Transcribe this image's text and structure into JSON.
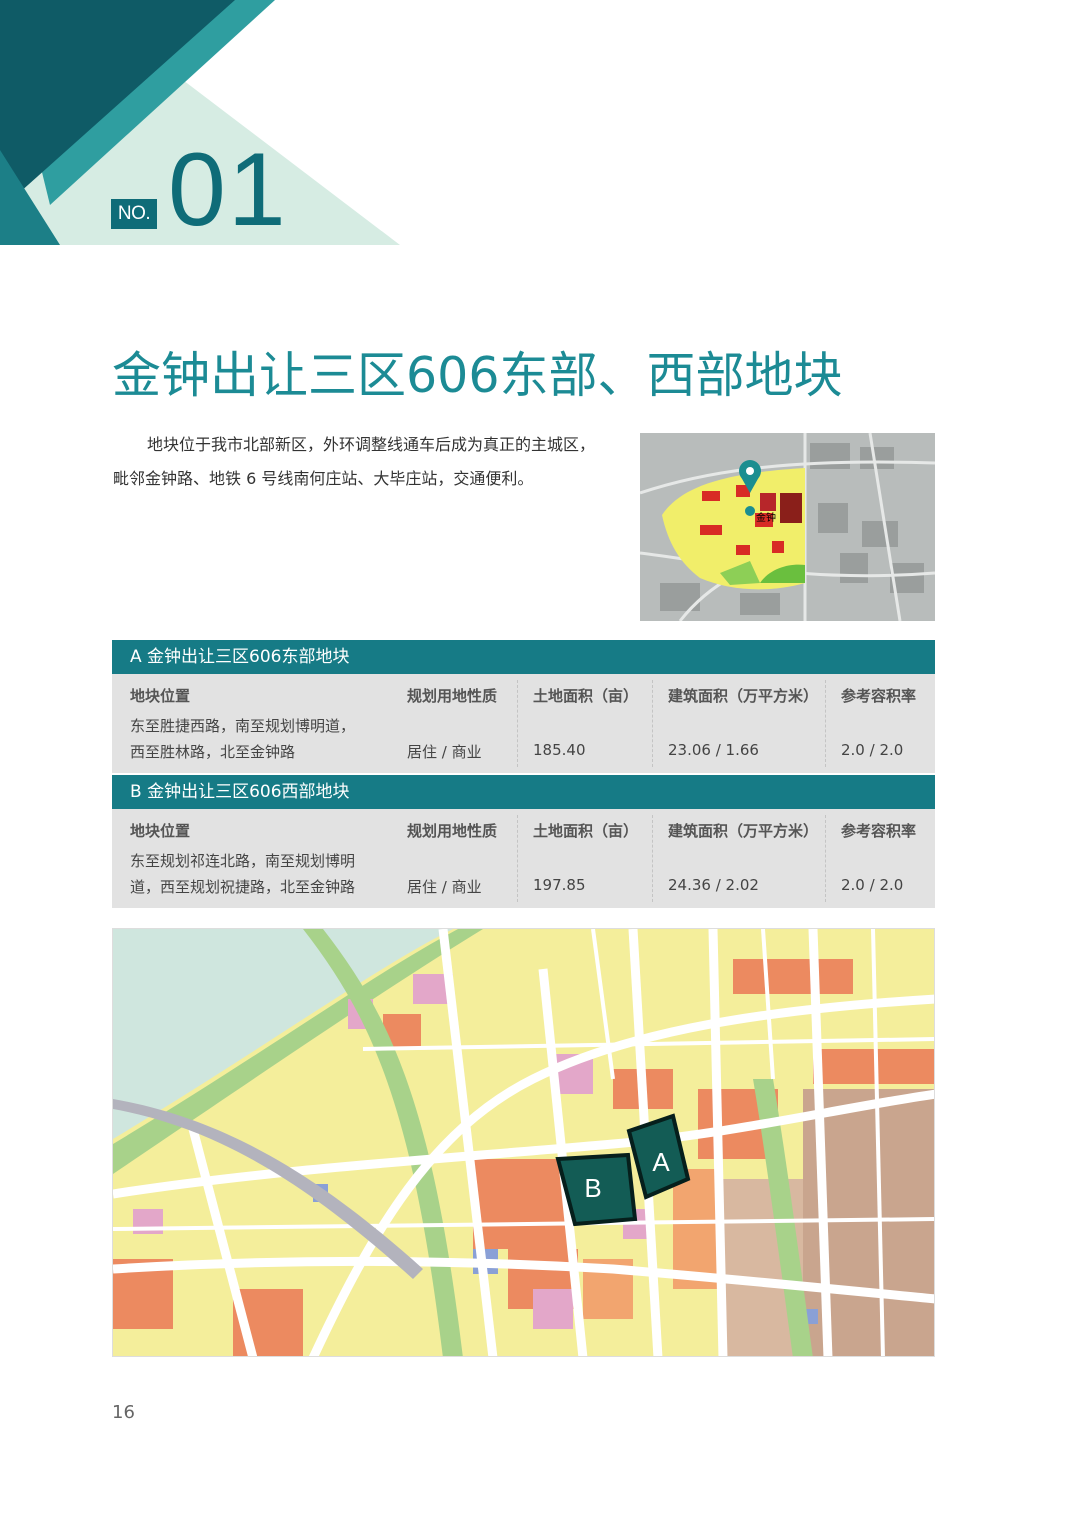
{
  "header": {
    "no_label": "NO.",
    "number": "01"
  },
  "title": "金钟出让三区606东部、西部地块",
  "intro": {
    "line1": "地块位于我市北部新区，外环调整线通车后成为真正的主城区，",
    "line2": "毗邻金钟路、地铁 6 号线南何庄站、大毕庄站，交通便利。"
  },
  "thumbnail": {
    "pin_label": "金钟"
  },
  "columns": {
    "location": "地块位置",
    "use": "规划用地性质",
    "land_area": "土地面积（亩）",
    "floor_area": "建筑面积（万平方米）",
    "far": "参考容积率"
  },
  "parcels": [
    {
      "title": "A 金钟出让三区606东部地块",
      "location_line1": "东至胜捷西路，南至规划博明道，",
      "location_line2": "西至胜林路，北至金钟路",
      "use": "居住 / 商业",
      "land_area": "185.40",
      "floor_area": "23.06 / 1.66",
      "far": "2.0 / 2.0"
    },
    {
      "title": "B 金钟出让三区606西部地块",
      "location_line1": "东至规划祁连北路，南至规划博明",
      "location_line2": "道，西至规划祝捷路，北至金钟路",
      "use": "居住 / 商业",
      "land_area": "197.85",
      "floor_area": "24.36 / 2.02",
      "far": "2.0 / 2.0"
    }
  ],
  "map": {
    "label_a": "A",
    "label_b": "B"
  },
  "page_number": "16",
  "colors": {
    "teal_dark": "#0f6c78",
    "teal": "#167b86",
    "mint": "#d6ece3",
    "residential": "#f4ee9b",
    "commercial": "#ec8a60",
    "industrial": "#c9a58e",
    "green": "#a8d28a",
    "road": "#ffffff"
  }
}
